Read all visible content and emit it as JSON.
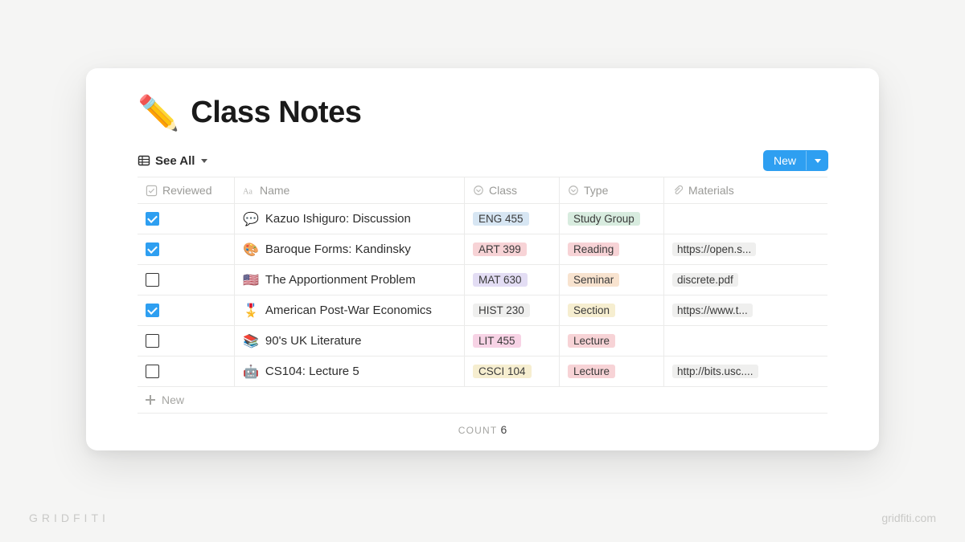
{
  "page": {
    "emoji": "✏️",
    "title": "Class Notes"
  },
  "toolbar": {
    "view_label": "See All",
    "new_label": "New"
  },
  "columns": {
    "reviewed": "Reviewed",
    "name": "Name",
    "class": "Class",
    "type": "Type",
    "materials": "Materials"
  },
  "tag_colors": {
    "ENG 455": "#d7e6f3",
    "ART 399": "#f7d3d6",
    "MAT 630": "#e3ddf4",
    "HIST 230": "#efefee",
    "LIT 455": "#f7d3e5",
    "CSCI 104": "#f6eed0",
    "Study Group": "#d8ecdf",
    "Reading": "#f7d3d6",
    "Seminar": "#f8e3cf",
    "Section": "#f6eed0",
    "Lecture": "#f7d3d6"
  },
  "rows": [
    {
      "reviewed": true,
      "emoji": "💬",
      "name": "Kazuo Ishiguro: Discussion",
      "class": "ENG 455",
      "type": "Study Group",
      "material": ""
    },
    {
      "reviewed": true,
      "emoji": "🎨",
      "name": "Baroque Forms: Kandinsky",
      "class": "ART 399",
      "type": "Reading",
      "material": "https://open.s..."
    },
    {
      "reviewed": false,
      "emoji": "🇺🇸",
      "name": "The Apportionment Problem",
      "class": "MAT 630",
      "type": "Seminar",
      "material": "discrete.pdf"
    },
    {
      "reviewed": true,
      "emoji": "🎖️",
      "name": "American Post-War Economics",
      "class": "HIST 230",
      "type": "Section",
      "material": "https://www.t..."
    },
    {
      "reviewed": false,
      "emoji": "📚",
      "name": "90's UK Literature",
      "class": "LIT 455",
      "type": "Lecture",
      "material": ""
    },
    {
      "reviewed": false,
      "emoji": "🤖",
      "name": "CS104: Lecture 5",
      "class": "CSCI 104",
      "type": "Lecture",
      "material": "http://bits.usc...."
    }
  ],
  "addrow_label": "New",
  "count": {
    "label": "COUNT",
    "value": "6"
  },
  "footer": {
    "left": "GRIDFITI",
    "right": "gridfiti.com"
  }
}
